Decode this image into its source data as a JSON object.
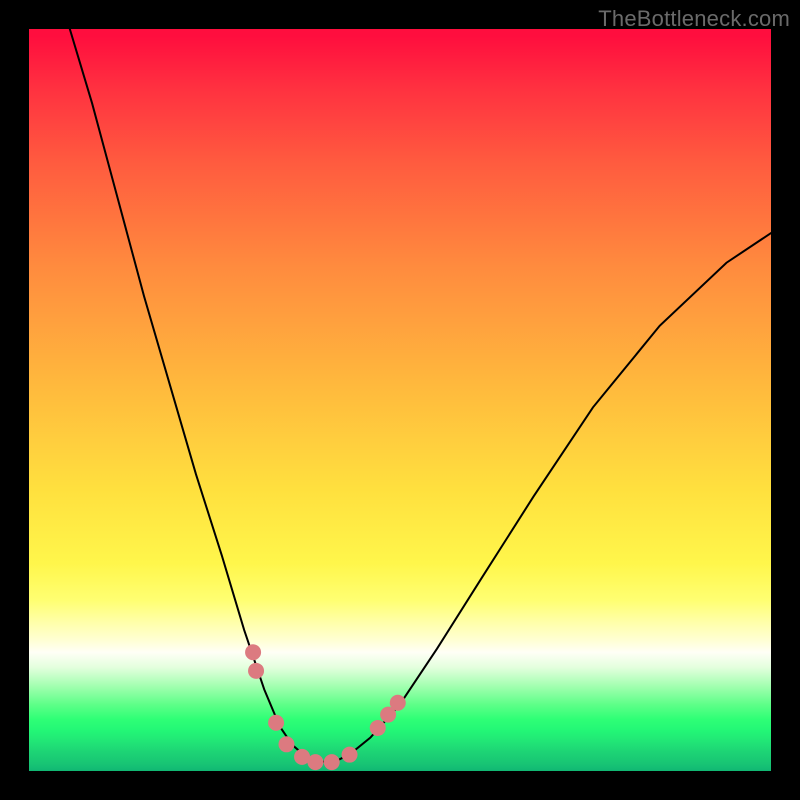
{
  "watermark": {
    "text": "TheBottleneck.com"
  },
  "chart_data": {
    "type": "line",
    "title": "",
    "xlabel": "",
    "ylabel": "",
    "xlim": [
      0,
      100
    ],
    "ylim": [
      0,
      100
    ],
    "grid": false,
    "legend_visible": false,
    "background_gradient": {
      "orientation": "vertical",
      "stops": [
        {
          "pos": 0.0,
          "color": "#ff0e3e"
        },
        {
          "pos": 0.5,
          "color": "#ffc63d"
        },
        {
          "pos": 0.78,
          "color": "#ffff8a"
        },
        {
          "pos": 0.86,
          "color": "#e4ffde"
        },
        {
          "pos": 0.93,
          "color": "#2fff76"
        },
        {
          "pos": 1.0,
          "color": "#11b773"
        }
      ]
    },
    "series": [
      {
        "name": "left-curve",
        "color": "#000000",
        "width": 2,
        "x": [
          5.5,
          8.5,
          12.0,
          15.5,
          19.0,
          22.5,
          26.0,
          29.0,
          31.7,
          33.8,
          35.5,
          37.0,
          38.2,
          39.2,
          40.2
        ],
        "y": [
          100.0,
          90.0,
          77.0,
          64.0,
          52.0,
          40.0,
          29.0,
          19.0,
          11.0,
          6.0,
          3.5,
          2.2,
          1.6,
          1.3,
          1.2
        ]
      },
      {
        "name": "right-curve",
        "color": "#000000",
        "width": 2,
        "x": [
          40.2,
          41.5,
          43.3,
          46.0,
          50.0,
          55.0,
          61.0,
          68.0,
          76.0,
          85.0,
          94.0,
          100.0
        ],
        "y": [
          1.2,
          1.4,
          2.3,
          4.5,
          9.0,
          16.5,
          26.0,
          37.0,
          49.0,
          60.0,
          68.5,
          72.5
        ]
      }
    ],
    "markers": {
      "color": "#dc7a80",
      "radius": 8,
      "points": [
        {
          "x": 30.2,
          "y": 16.0
        },
        {
          "x": 30.6,
          "y": 13.5
        },
        {
          "x": 33.3,
          "y": 6.5
        },
        {
          "x": 34.7,
          "y": 3.6
        },
        {
          "x": 36.8,
          "y": 1.9
        },
        {
          "x": 38.6,
          "y": 1.2
        },
        {
          "x": 40.8,
          "y": 1.2
        },
        {
          "x": 43.2,
          "y": 2.2
        },
        {
          "x": 47.0,
          "y": 5.8
        },
        {
          "x": 48.4,
          "y": 7.6
        },
        {
          "x": 49.7,
          "y": 9.2
        }
      ]
    }
  }
}
